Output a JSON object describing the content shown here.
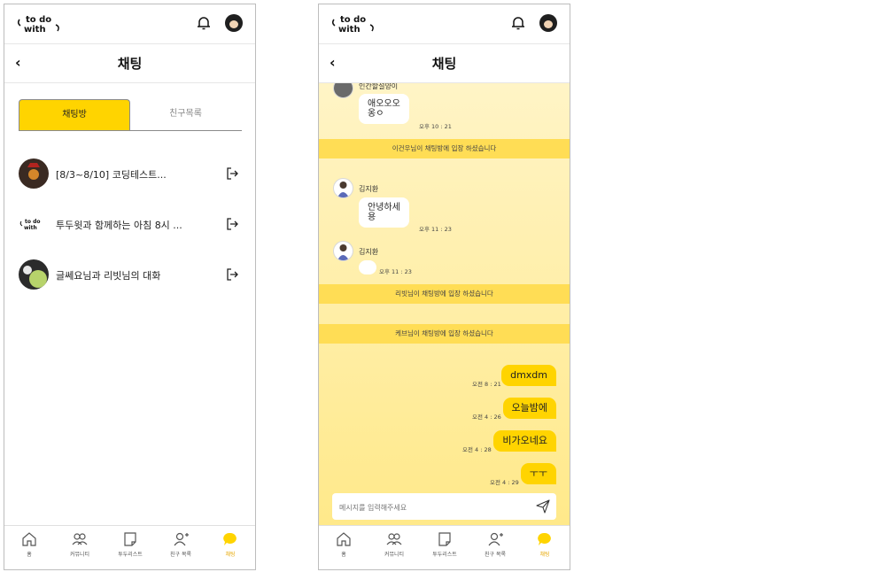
{
  "app": {
    "logo_alt": "to do with",
    "nav": [
      {
        "label": "홈",
        "icon": "home-icon"
      },
      {
        "label": "커뮤니티",
        "icon": "community-icon"
      },
      {
        "label": "투두리스트",
        "icon": "todolist-icon"
      },
      {
        "label": "친구 목록",
        "icon": "friend-add-icon"
      },
      {
        "label": "채팅",
        "icon": "chat-icon"
      }
    ],
    "accent": "#ffd400"
  },
  "left": {
    "title": "채팅",
    "tabs": [
      "채팅방",
      "친구목록"
    ],
    "rooms": [
      {
        "name": "[8/3~8/10] 코딩테스트..."
      },
      {
        "name": "투두윗과 함께하는 아침 8시 ..."
      },
      {
        "name": "글쎄요님과 리빗님의 대화"
      }
    ]
  },
  "right": {
    "title": "채팅",
    "messages": {
      "m1_sender": "인간할설양이",
      "m1_text": "애오오오\n옹ㅇ",
      "m1_time": "오후 10 : 21",
      "sys1": "이건우님이 채팅방에 입장 하셨습니다",
      "m2_sender": "김지환",
      "m2_text": "안녕하세\n용",
      "m2_time": "오후 11 : 23",
      "m3_sender": "김지환",
      "m3_text": "",
      "m3_time": "오후 11 : 23",
      "sys2": "리빗님이 채팅방에 입장 하셨습니다",
      "sys3": "케브님이 채팅방에 입장 하셨습니다",
      "out1_text": "dmxdm",
      "out1_time": "오전 8 : 21",
      "out2_text": "오늘밤에",
      "out2_time": "오전 4 : 26",
      "out3_text": "비가오네요",
      "out3_time": "오전 4 : 28",
      "out4_text": "ㅜㅜ",
      "out4_time": "오전 4 : 29"
    },
    "input_placeholder": "메시지를 입력해주세요"
  }
}
